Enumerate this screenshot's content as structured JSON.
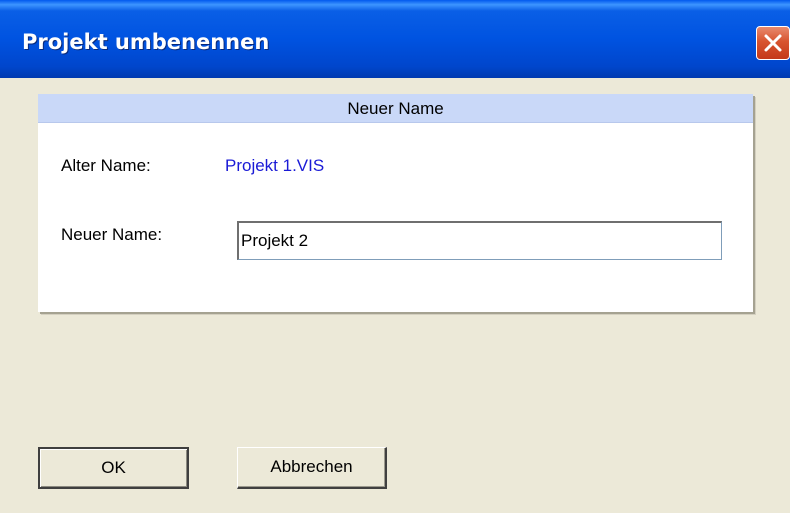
{
  "window": {
    "title": "Projekt umbenennen",
    "close_icon": "close-icon"
  },
  "panel": {
    "header": "Neuer Name",
    "old_name_label": "Alter Name:",
    "old_name_value": "Projekt 1.VIS",
    "new_name_label": "Neuer Name:",
    "new_name_value": "Projekt 2"
  },
  "buttons": {
    "ok_label": "OK",
    "cancel_label": "Abbrechen"
  },
  "colors": {
    "titlebar": "#0053E1",
    "dialog_background": "#ECE9D8",
    "panel_header": "#C9D8F8",
    "old_name_value": "#1A1AD6",
    "close_button": "#D8542F"
  }
}
